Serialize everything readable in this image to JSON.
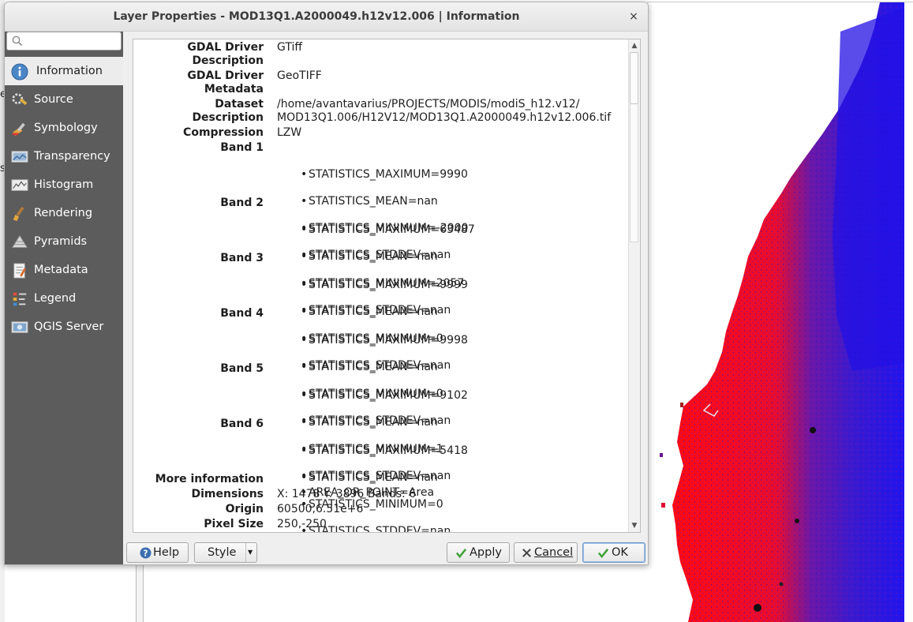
{
  "dialog": {
    "title": "Layer Properties - MOD13Q1.A2000049.h12v12.006 | Information",
    "close_glyph": "×"
  },
  "search": {
    "placeholder": "",
    "value": ""
  },
  "sidebar": {
    "items": [
      {
        "label": "Information",
        "icon": "info-icon",
        "active": true
      },
      {
        "label": "Source",
        "icon": "source-wrench-icon"
      },
      {
        "label": "Symbology",
        "icon": "symbology-brush-icon"
      },
      {
        "label": "Transparency",
        "icon": "transparency-icon"
      },
      {
        "label": "Histogram",
        "icon": "histogram-icon"
      },
      {
        "label": "Rendering",
        "icon": "rendering-brush-icon"
      },
      {
        "label": "Pyramids",
        "icon": "pyramids-icon"
      },
      {
        "label": "Metadata",
        "icon": "metadata-icon"
      },
      {
        "label": "Legend",
        "icon": "legend-icon"
      },
      {
        "label": "QGIS Server",
        "icon": "qgis-server-icon"
      }
    ]
  },
  "info": {
    "gdal_driver_description_key": "GDAL Driver\nDescription",
    "gdal_driver_description_val": "GTiff",
    "gdal_driver_metadata_key": "GDAL Driver\nMetadata",
    "gdal_driver_metadata_val": "GeoTIFF",
    "dataset_description_key": "Dataset\nDescription",
    "dataset_description_val": "/home/avantavarius/PROJECTS/MODIS/modiS_h12.v12/\nMOD13Q1.006/H12V12/MOD13Q1.A2000049.h12v12.006.tif",
    "compression_key": "Compression",
    "compression_val": "LZW",
    "bands": [
      {
        "label": "Band 1",
        "stats": [
          "STATISTICS_MAXIMUM=9990",
          "STATISTICS_MEAN=nan",
          "STATISTICS_MINIMUM=-2000",
          "STATISTICS_STDDEV=nan"
        ]
      },
      {
        "label": "Band 2",
        "stats": [
          "STATISTICS_MAXIMUM=63487",
          "STATISTICS_MEAN=nan",
          "STATISTICS_MINIMUM=2057",
          "STATISTICS_STDDEV=nan"
        ]
      },
      {
        "label": "Band 3",
        "stats": [
          "STATISTICS_MAXIMUM=9999",
          "STATISTICS_MEAN=nan",
          "STATISTICS_MINIMUM=0",
          "STATISTICS_STDDEV=nan"
        ]
      },
      {
        "label": "Band 4",
        "stats": [
          "STATISTICS_MAXIMUM=9998",
          "STATISTICS_MEAN=nan",
          "STATISTICS_MINIMUM=0",
          "STATISTICS_STDDEV=nan"
        ]
      },
      {
        "label": "Band 5",
        "stats": [
          "STATISTICS_MAXIMUM=9102",
          "STATISTICS_MEAN=nan",
          "STATISTICS_MINIMUM=1",
          "STATISTICS_STDDEV=nan"
        ]
      },
      {
        "label": "Band 6",
        "stats": [
          "STATISTICS_MAXIMUM=5418",
          "STATISTICS_MEAN=nan",
          "STATISTICS_MINIMUM=0",
          "STATISTICS_STDDEV=nan"
        ]
      }
    ],
    "more_information_key": "More information",
    "more_information_val": "AREA_OR_POINT=Area",
    "dimensions_key": "Dimensions",
    "dimensions_val": "X: 1478 Y: 3896 Bands: 6",
    "origin_key": "Origin",
    "origin_val": "60500,6.51e+6",
    "pixel_size_key": "Pixel Size",
    "pixel_size_val": "250,-250"
  },
  "buttons": {
    "help": "Help",
    "style": "Style",
    "apply": "Apply",
    "cancel": "Cancel",
    "ok": "OK"
  },
  "colors": {
    "sidebar_bg": "#5c5c5c",
    "map_red": "#ff0a14",
    "map_blue": "#2a17e6",
    "map_purple": "#5a1ab0",
    "ok_check": "#3aa232"
  }
}
